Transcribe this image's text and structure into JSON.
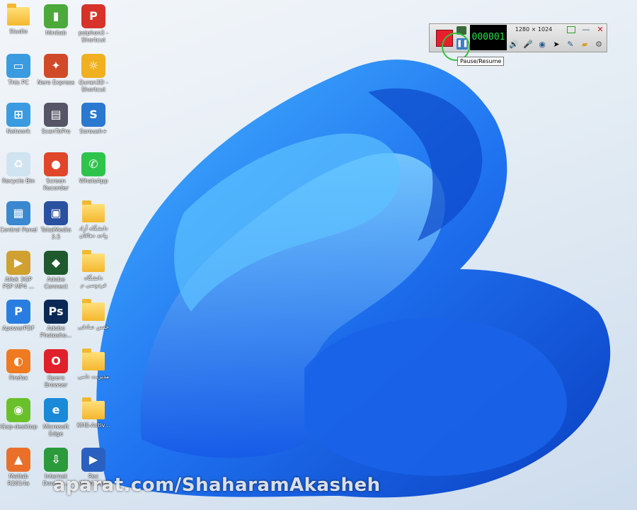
{
  "desktop": {
    "icons": [
      {
        "label": "Studio",
        "kind": "folder"
      },
      {
        "label": "Minitab",
        "kind": "minitab-icon"
      },
      {
        "label": "psiphon3 - Shortcut",
        "kind": "psiphon-icon"
      },
      {
        "label": "This PC",
        "kind": "this-pc-icon"
      },
      {
        "label": "Nero Express",
        "kind": "nero-icon"
      },
      {
        "label": "Quran3D - Shortcut",
        "kind": "quran-icon"
      },
      {
        "label": "Network",
        "kind": "network-icon"
      },
      {
        "label": "ScanToPro",
        "kind": "scanner-icon"
      },
      {
        "label": "Soroush+",
        "kind": "soroush-icon"
      },
      {
        "label": "Recycle Bin",
        "kind": "recycle-bin-icon"
      },
      {
        "label": "Screen Recorder",
        "kind": "screen-recorder-icon"
      },
      {
        "label": "WhatsApp",
        "kind": "whatsapp-icon"
      },
      {
        "label": "Control Panel",
        "kind": "control-panel-icon"
      },
      {
        "label": "TotalMedia 3.5",
        "kind": "totalmedia-icon"
      },
      {
        "label": "دانشگاه آزاد واحد دهاقان",
        "kind": "folder"
      },
      {
        "label": "Allok 3GP PSP MP4 ...",
        "kind": "allok-icon"
      },
      {
        "label": "Adobe Connect",
        "kind": "adobe-connect-icon"
      },
      {
        "label": "دانشگاه فردوسی م",
        "kind": "folder"
      },
      {
        "label": "ApowerPDF",
        "kind": "apowerpdf-icon"
      },
      {
        "label": "Adobe Photosho...",
        "kind": "photoshop-icon"
      },
      {
        "label": "حسن صادقی",
        "kind": "folder"
      },
      {
        "label": "Firefox",
        "kind": "firefox-icon"
      },
      {
        "label": "Opera Browser",
        "kind": "opera-icon"
      },
      {
        "label": "مدیریت دامی",
        "kind": "folder"
      },
      {
        "label": "iGap-desktop",
        "kind": "igap-icon"
      },
      {
        "label": "Microsoft Edge",
        "kind": "edge-icon"
      },
      {
        "label": "KMS-Activ...",
        "kind": "folder"
      },
      {
        "label": "Matlab R2014a",
        "kind": "matlab-icon"
      },
      {
        "label": "Internet Downlo...",
        "kind": "idm-icon"
      },
      {
        "label": "Rec 0004.mp4",
        "kind": "video-file-icon"
      }
    ]
  },
  "recorder": {
    "counter": "000001",
    "resolution": "1280 × 1024",
    "tooltip": "Pause/Resume",
    "accent": "#e81e2d"
  },
  "watermark": "aparat.com/ShaharamAkasheh"
}
